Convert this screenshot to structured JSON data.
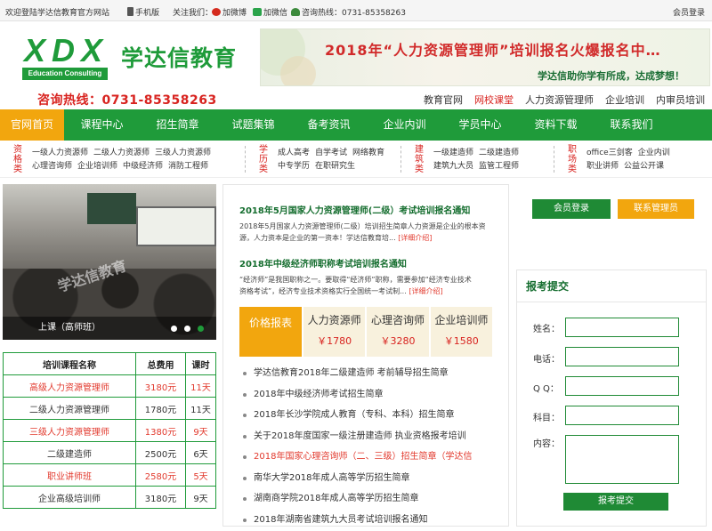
{
  "topbar": {
    "welcome": "欢迎登陆学达信教育官方网站",
    "mobile": "手机版",
    "follow": "关注我们：",
    "weibo": "加微博",
    "weixin": "加微信",
    "hotline": "咨询热线：0731-85358263",
    "login": "会员登录"
  },
  "header": {
    "logo_letters": "XDX",
    "logo_sub": "Education Consulting",
    "brand": "学达信教育",
    "banner_title": "2018年“人力资源管理师”培训报名火爆报名中…",
    "banner_sub": "学达信助你学有所成，达成梦想！",
    "hotline": "咨询热线：0731-85358263"
  },
  "quicknav": [
    "教育官网",
    "网校课堂",
    "人力资源管理师",
    "企业培训",
    "内审员培训"
  ],
  "mainnav": [
    "官网首页",
    "课程中心",
    "招生简章",
    "试题集锦",
    "备考资讯",
    "企业内训",
    "学员中心",
    "资料下载",
    "联系我们"
  ],
  "categories": [
    {
      "title": "资格类",
      "links": [
        [
          "一级人力资源师",
          "二级人力资源师",
          "三级人力资源师"
        ],
        [
          "心理咨询师",
          "企业培训师",
          "中级经济师",
          "消防工程师"
        ]
      ]
    },
    {
      "title": "学历类",
      "links": [
        [
          "成人高考",
          "自学考试",
          "网络教育"
        ],
        [
          "中专学历",
          "在职研究生"
        ]
      ]
    },
    {
      "title": "建筑类",
      "links": [
        [
          "一级建造师",
          "二级建造师"
        ],
        [
          "建筑九大员",
          "监管工程师"
        ]
      ]
    },
    {
      "title": "职场类",
      "links": [
        [
          "office三剑客",
          "企业内训"
        ],
        [
          "职业讲师",
          "公益公开课"
        ]
      ]
    }
  ],
  "slider": {
    "caption": "上课（高师班）",
    "watermark": "学达信教育"
  },
  "fee_table": {
    "headers": [
      "培训课程名称",
      "总费用",
      "课时"
    ],
    "rows": [
      {
        "name": "高级人力资源管理师",
        "fee": "3180元",
        "hours": "11天",
        "hl": true
      },
      {
        "name": "二级人力资源管理师",
        "fee": "1780元",
        "hours": "11天",
        "hl": false
      },
      {
        "name": "三级人力资源管理师",
        "fee": "1380元",
        "hours": "9天",
        "hl": true
      },
      {
        "name": "二级建造师",
        "fee": "2500元",
        "hours": "6天",
        "hl": false
      },
      {
        "name": "职业讲师班",
        "fee": "2580元",
        "hours": "5天",
        "hl": true
      },
      {
        "name": "企业高级培训师",
        "fee": "3180元",
        "hours": "9天",
        "hl": false
      }
    ]
  },
  "news": {
    "item1": {
      "title": "2018年5月国家人力资源管理师(二级）考试培训报名通知",
      "line1": "2018年5月国家人力资源管理师(二级）培训招生简章人力资源是企业的根本资",
      "line2": "源，人力资本是企业的第一资本！学达信教育培...",
      "more": "[详细介绍]"
    },
    "item2": {
      "title": "2018年中级经济师职称考试培训报名通知",
      "line1": "“经济师”是我国职称之一。要取得“经济师”职称，需要参加“经济专业技术",
      "line2": "资格考试”，经济专业技术资格实行全国统一考试制...",
      "more": "[详细介绍]"
    },
    "price_label": "价格报表",
    "prices": [
      {
        "name": "人力资源师",
        "value": "￥1780"
      },
      {
        "name": "心理咨询师",
        "value": "￥3280"
      },
      {
        "name": "企业培训师",
        "value": "￥1580"
      }
    ],
    "list": [
      {
        "text": "学达信教育2018年二级建造师 考前辅导招生简章",
        "hl": false
      },
      {
        "text": "2018年中级经济师考试招生简章",
        "hl": false
      },
      {
        "text": "2018年长沙学院成人教育（专科、本科）招生简章",
        "hl": false
      },
      {
        "text": "关于2018年度国家一级注册建造师 执业资格报考培训",
        "hl": false
      },
      {
        "text": "2018年国家心理咨询师（二、三级）招生简章（学达信",
        "hl": true
      },
      {
        "text": "南华大学2018年成人高等学历招生简章",
        "hl": false
      },
      {
        "text": "湖南商学院2018年成人高等学历招生简章",
        "hl": false
      },
      {
        "text": "2018年湖南省建筑九大员考试培训报名通知",
        "hl": false
      }
    ]
  },
  "side": {
    "member_login": "会员登录",
    "contact_admin": "联系管理员",
    "form_title": "报考提交",
    "labels": [
      "姓名：",
      "电话：",
      "Q Q：",
      "科目：",
      "内容："
    ],
    "submit": "报考提交"
  },
  "colors": {
    "green": "#1f9b3a",
    "orange": "#f2a60e",
    "red": "#d8231f"
  }
}
